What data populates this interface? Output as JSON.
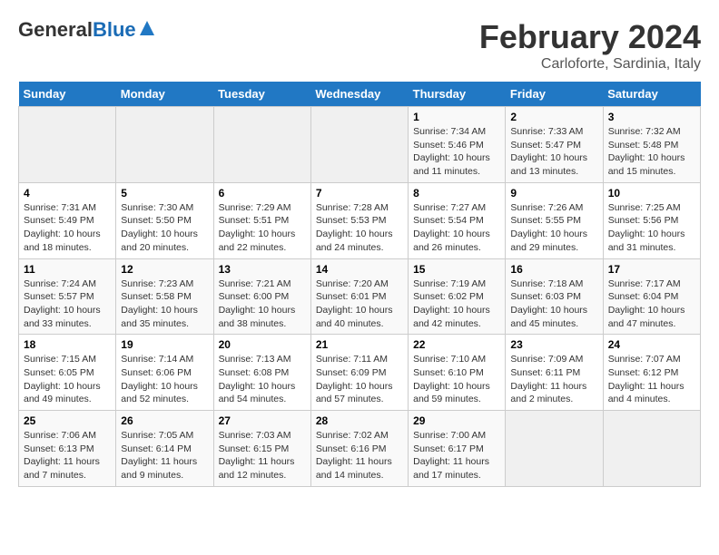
{
  "header": {
    "logo_general": "General",
    "logo_blue": "Blue",
    "month_title": "February 2024",
    "location": "Carloforte, Sardinia, Italy"
  },
  "days_of_week": [
    "Sunday",
    "Monday",
    "Tuesday",
    "Wednesday",
    "Thursday",
    "Friday",
    "Saturday"
  ],
  "weeks": [
    [
      {
        "day": "",
        "info": ""
      },
      {
        "day": "",
        "info": ""
      },
      {
        "day": "",
        "info": ""
      },
      {
        "day": "",
        "info": ""
      },
      {
        "day": "1",
        "info": "Sunrise: 7:34 AM\nSunset: 5:46 PM\nDaylight: 10 hours\nand 11 minutes."
      },
      {
        "day": "2",
        "info": "Sunrise: 7:33 AM\nSunset: 5:47 PM\nDaylight: 10 hours\nand 13 minutes."
      },
      {
        "day": "3",
        "info": "Sunrise: 7:32 AM\nSunset: 5:48 PM\nDaylight: 10 hours\nand 15 minutes."
      }
    ],
    [
      {
        "day": "4",
        "info": "Sunrise: 7:31 AM\nSunset: 5:49 PM\nDaylight: 10 hours\nand 18 minutes."
      },
      {
        "day": "5",
        "info": "Sunrise: 7:30 AM\nSunset: 5:50 PM\nDaylight: 10 hours\nand 20 minutes."
      },
      {
        "day": "6",
        "info": "Sunrise: 7:29 AM\nSunset: 5:51 PM\nDaylight: 10 hours\nand 22 minutes."
      },
      {
        "day": "7",
        "info": "Sunrise: 7:28 AM\nSunset: 5:53 PM\nDaylight: 10 hours\nand 24 minutes."
      },
      {
        "day": "8",
        "info": "Sunrise: 7:27 AM\nSunset: 5:54 PM\nDaylight: 10 hours\nand 26 minutes."
      },
      {
        "day": "9",
        "info": "Sunrise: 7:26 AM\nSunset: 5:55 PM\nDaylight: 10 hours\nand 29 minutes."
      },
      {
        "day": "10",
        "info": "Sunrise: 7:25 AM\nSunset: 5:56 PM\nDaylight: 10 hours\nand 31 minutes."
      }
    ],
    [
      {
        "day": "11",
        "info": "Sunrise: 7:24 AM\nSunset: 5:57 PM\nDaylight: 10 hours\nand 33 minutes."
      },
      {
        "day": "12",
        "info": "Sunrise: 7:23 AM\nSunset: 5:58 PM\nDaylight: 10 hours\nand 35 minutes."
      },
      {
        "day": "13",
        "info": "Sunrise: 7:21 AM\nSunset: 6:00 PM\nDaylight: 10 hours\nand 38 minutes."
      },
      {
        "day": "14",
        "info": "Sunrise: 7:20 AM\nSunset: 6:01 PM\nDaylight: 10 hours\nand 40 minutes."
      },
      {
        "day": "15",
        "info": "Sunrise: 7:19 AM\nSunset: 6:02 PM\nDaylight: 10 hours\nand 42 minutes."
      },
      {
        "day": "16",
        "info": "Sunrise: 7:18 AM\nSunset: 6:03 PM\nDaylight: 10 hours\nand 45 minutes."
      },
      {
        "day": "17",
        "info": "Sunrise: 7:17 AM\nSunset: 6:04 PM\nDaylight: 10 hours\nand 47 minutes."
      }
    ],
    [
      {
        "day": "18",
        "info": "Sunrise: 7:15 AM\nSunset: 6:05 PM\nDaylight: 10 hours\nand 49 minutes."
      },
      {
        "day": "19",
        "info": "Sunrise: 7:14 AM\nSunset: 6:06 PM\nDaylight: 10 hours\nand 52 minutes."
      },
      {
        "day": "20",
        "info": "Sunrise: 7:13 AM\nSunset: 6:08 PM\nDaylight: 10 hours\nand 54 minutes."
      },
      {
        "day": "21",
        "info": "Sunrise: 7:11 AM\nSunset: 6:09 PM\nDaylight: 10 hours\nand 57 minutes."
      },
      {
        "day": "22",
        "info": "Sunrise: 7:10 AM\nSunset: 6:10 PM\nDaylight: 10 hours\nand 59 minutes."
      },
      {
        "day": "23",
        "info": "Sunrise: 7:09 AM\nSunset: 6:11 PM\nDaylight: 11 hours\nand 2 minutes."
      },
      {
        "day": "24",
        "info": "Sunrise: 7:07 AM\nSunset: 6:12 PM\nDaylight: 11 hours\nand 4 minutes."
      }
    ],
    [
      {
        "day": "25",
        "info": "Sunrise: 7:06 AM\nSunset: 6:13 PM\nDaylight: 11 hours\nand 7 minutes."
      },
      {
        "day": "26",
        "info": "Sunrise: 7:05 AM\nSunset: 6:14 PM\nDaylight: 11 hours\nand 9 minutes."
      },
      {
        "day": "27",
        "info": "Sunrise: 7:03 AM\nSunset: 6:15 PM\nDaylight: 11 hours\nand 12 minutes."
      },
      {
        "day": "28",
        "info": "Sunrise: 7:02 AM\nSunset: 6:16 PM\nDaylight: 11 hours\nand 14 minutes."
      },
      {
        "day": "29",
        "info": "Sunrise: 7:00 AM\nSunset: 6:17 PM\nDaylight: 11 hours\nand 17 minutes."
      },
      {
        "day": "",
        "info": ""
      },
      {
        "day": "",
        "info": ""
      }
    ]
  ]
}
